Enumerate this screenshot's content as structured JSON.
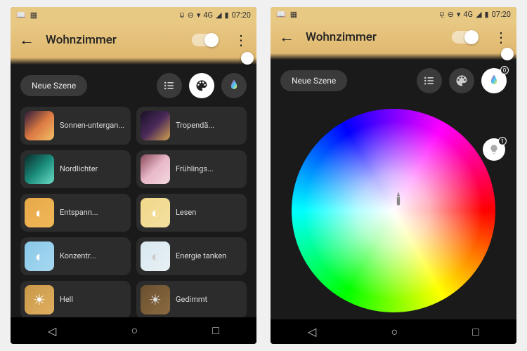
{
  "status": {
    "network": "4G",
    "time": "07:20"
  },
  "header": {
    "room": "Wohnzimmer"
  },
  "toolbar": {
    "new_scene": "Neue Szene"
  },
  "scenes": [
    {
      "label": "Sonnen-untergan...",
      "thumb": "t-sunset"
    },
    {
      "label": "Tropendä...",
      "thumb": "t-tropical"
    },
    {
      "label": "Nordlichter",
      "thumb": "t-northern"
    },
    {
      "label": "Frühlings...",
      "thumb": "t-spring"
    },
    {
      "label": "Entspann...",
      "thumb": "t-relax",
      "icon": "◐"
    },
    {
      "label": "Lesen",
      "thumb": "t-read",
      "icon": "◐"
    },
    {
      "label": "Konzentr...",
      "thumb": "t-focus",
      "icon": "◐"
    },
    {
      "label": "Energie tanken",
      "thumb": "t-energy",
      "icon": "◐"
    },
    {
      "label": "Hell",
      "thumb": "t-bright",
      "icon": "☀"
    },
    {
      "label": "Gedimmt",
      "thumb": "t-dim",
      "icon": "☀"
    }
  ],
  "badges": {
    "palette": "0",
    "bulb": "1"
  }
}
